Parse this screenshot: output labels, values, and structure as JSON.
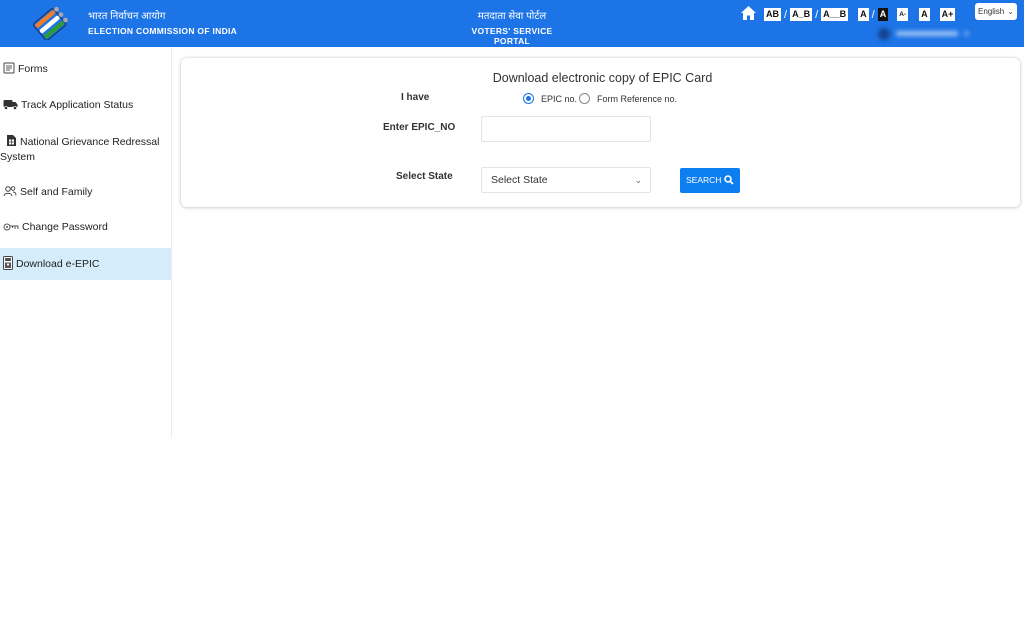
{
  "header": {
    "org_hindi": "भारत निर्वाचन आयोग",
    "org_english": "ELECTION COMMISSION OF INDIA",
    "portal_hindi": "मतदाता सेवा पोर्टल",
    "portal_english": "VOTERS' SERVICE PORTAL",
    "accessibility": {
      "spacing_options": [
        "AB",
        "A_B",
        "A__B"
      ],
      "contrast_options": [
        "A",
        "A"
      ],
      "font_size_options": [
        "A-",
        "A",
        "A+"
      ],
      "separator": "/"
    },
    "language": "English",
    "icons": {
      "home": "home-icon",
      "language_chevron": "chevron-down-icon"
    },
    "colors": {
      "brand_blue": "#1d74e6"
    }
  },
  "sidebar": {
    "items": [
      {
        "label": "Forms",
        "icon": "document-icon",
        "active": false
      },
      {
        "label": "Track Application Status",
        "icon": "truck-icon",
        "active": false
      },
      {
        "label": "National Grievance Redressal System",
        "icon": "calculator-document-icon",
        "active": false
      },
      {
        "label": "Self and Family",
        "icon": "people-icon",
        "active": false
      },
      {
        "label": "Change Password",
        "icon": "key-icon",
        "active": false
      },
      {
        "label": "Download e-EPIC",
        "icon": "id-card-icon",
        "active": true
      }
    ],
    "active_color": "#d5ecfb"
  },
  "main": {
    "title": "Download electronic copy of EPIC Card",
    "i_have_label": "I have",
    "radio_options": [
      {
        "label": "EPIC no.",
        "selected": true
      },
      {
        "label": "Form Reference no.",
        "selected": false
      }
    ],
    "epic_label": "Enter EPIC_NO",
    "epic_value": "",
    "state_label": "Select State",
    "state_selected": "Select State",
    "search_button": "SEARCH",
    "search_color": "#0d7ef0"
  }
}
